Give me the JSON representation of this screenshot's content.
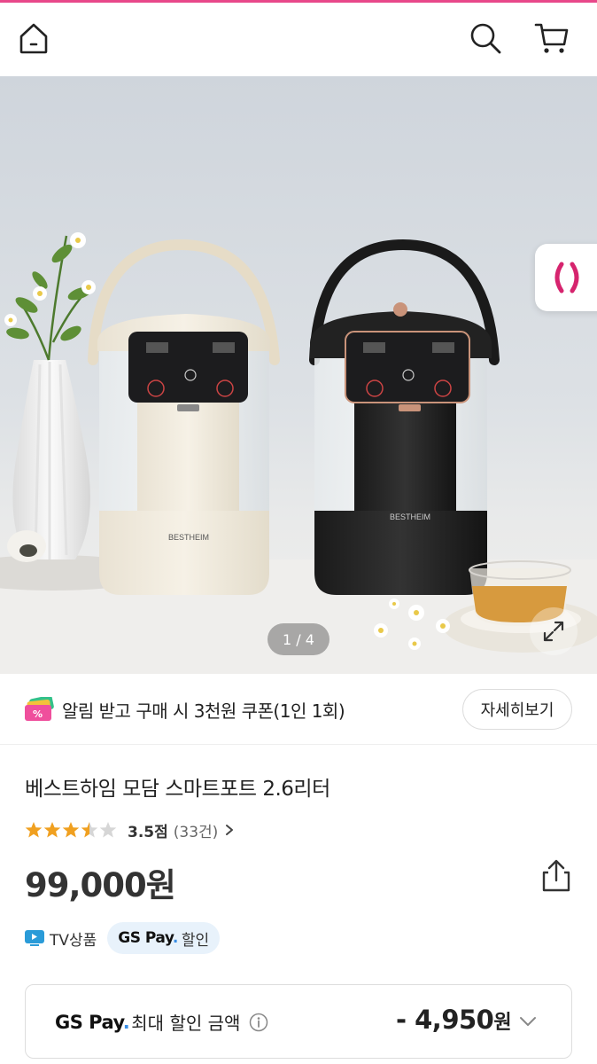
{
  "colors": {
    "accent": "#e8488a",
    "gspay_dot": "#3a8ee6",
    "star": "#f0a020"
  },
  "topbar": {
    "home_icon": "home-icon",
    "search_icon": "search-icon",
    "cart_icon": "cart-icon"
  },
  "hero": {
    "counter": "1 / 4",
    "brand_left": "BESTHEIM",
    "brand_right": "BESTHEIM"
  },
  "coupon": {
    "text_main": "알림 받고 구매 시 3천원 쿠폰",
    "text_sub": "(1인 1회)",
    "button": "자세히보기"
  },
  "product": {
    "title": "베스트하임 모담 스마트포트 2.6리터",
    "rating": {
      "stars": 3.5,
      "score": "3.5점",
      "count": "(33건)"
    },
    "price": "99,000원"
  },
  "tags": {
    "tv": "TV상품",
    "gspay_logo": "GS Pay",
    "gspay_dot": ".",
    "gspay_discount": "할인"
  },
  "gspay_box": {
    "logo": "GS Pay",
    "logo_dot": ".",
    "label": "최대 할인 금액",
    "amount": "- 4,950",
    "unit": "원"
  }
}
